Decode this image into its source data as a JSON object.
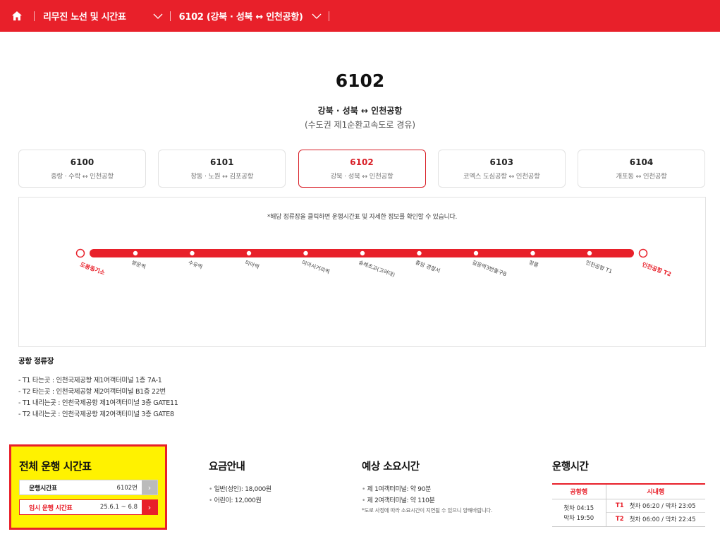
{
  "nav": {
    "home_icon": "home-icon",
    "crumb1": "리무진 노선 및 시간표",
    "crumb2": "6102 (강북 · 성북 ↔ 인천공항)"
  },
  "header": {
    "route_number": "6102",
    "route_name": "강북 · 성북 ↔ 인천공항",
    "via": "(수도권 제1순환고속도로 경유)"
  },
  "routes": [
    {
      "num": "6100",
      "desc": "중랑 · 수락 ↔ 인천공항"
    },
    {
      "num": "6101",
      "desc": "창동 · 노원 ↔ 김포공항"
    },
    {
      "num": "6102",
      "desc": "강북 · 성북 ↔ 인천공항"
    },
    {
      "num": "6103",
      "desc": "코엑스 도심공항 ↔ 인천공항"
    },
    {
      "num": "6104",
      "desc": "개포동 ↔ 인천공항"
    }
  ],
  "map": {
    "note": "*해당 정류장을 클릭하면 운행시간표 및 자세한 정보를 확인할 수 있습니다.",
    "accent": "#e8202a",
    "start": "도봉동기소",
    "end": "인천공항 T2",
    "stops": [
      "쌍문역",
      "수유역",
      "미아역",
      "미아사거리역",
      "숭례초교(고려대)",
      "종암 경찰서",
      "길음역3번출구B",
      "정릉",
      "인천공항 T1"
    ]
  },
  "airport_stops": {
    "title": "공항 정류장",
    "items": [
      "- T1 타는곳 : 인천국제공항 제1여객터미널 1층 7A-1",
      "- T2 타는곳 : 인천국제공항 제2여객터미널 B1층 22번",
      "- T1 내리는곳 : 인천국제공항 제1여객터미널 3층 GATE11",
      "- T2 내리는곳 : 인천국제공항 제2여객터미널 3층 GATE8"
    ]
  },
  "timetable": {
    "title": "전체 운행 시간표",
    "btn1_label": "운행시간표",
    "btn1_value": "6102번",
    "btn2_label": "임시 운행 시간표",
    "btn2_value": "25.6.1 ~ 6.8"
  },
  "fare": {
    "title": "요금안내",
    "items": [
      "일반(성인): 18,000원",
      "어린이: 12,000원"
    ]
  },
  "duration": {
    "title": "예상 소요시간",
    "items": [
      "제 1여객터미널: 약 90분",
      "제 2여객터미널: 약 110분"
    ],
    "note": "*도로 사정에 따라 소요시간이 지연될 수 있으니 양해바랍니다."
  },
  "hours": {
    "title": "운행시간",
    "col1": "공항행",
    "col2": "시내행",
    "first": "첫차 04:15",
    "last": "막차 19:50",
    "t1_label": "T1",
    "t1_value": "첫차 06:20 / 막차 23:05",
    "t2_label": "T2",
    "t2_value": "첫차 06:00 / 막차 22:45"
  }
}
